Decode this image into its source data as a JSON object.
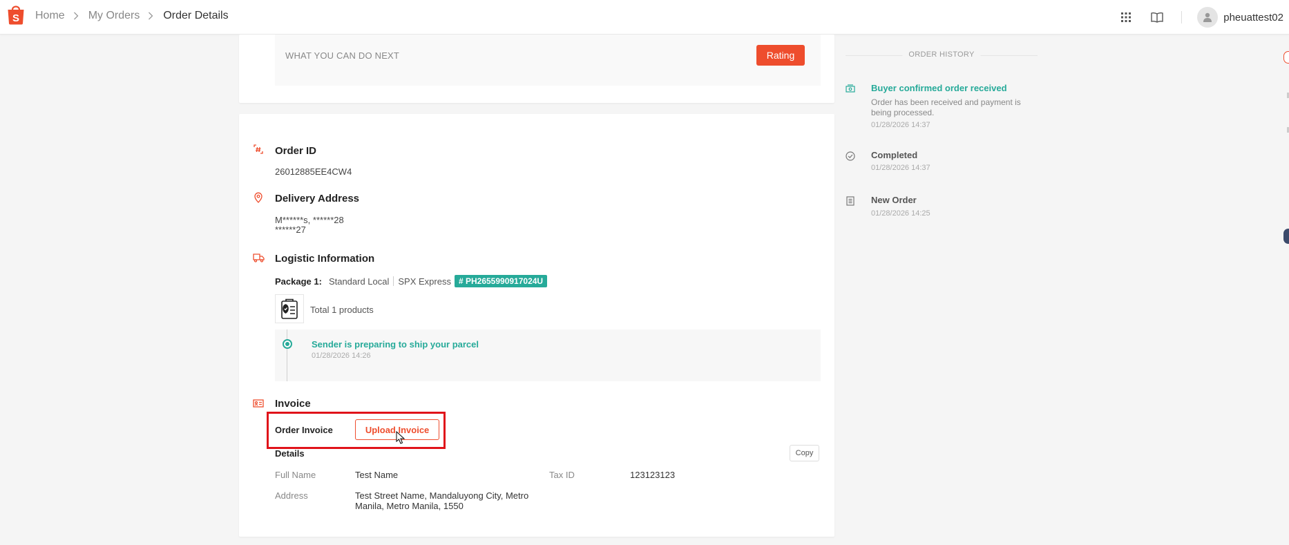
{
  "header": {
    "breadcrumb": [
      "Home",
      "My Orders",
      "Order Details"
    ],
    "username": "pheuattest02"
  },
  "next_actions": {
    "label": "WHAT YOU CAN DO NEXT",
    "rating_button": "Rating"
  },
  "order": {
    "order_id_title": "Order ID",
    "order_id": "26012885EE4CW4",
    "delivery_title": "Delivery Address",
    "address_line1": "M******s, ******28",
    "address_line2": "******27",
    "logistic_title": "Logistic Information",
    "package_label": "Package 1:",
    "shipping_type": "Standard Local",
    "carrier": "SPX Express",
    "tracking_number": "# PH2655990917024U",
    "product_count": "Total 1 products",
    "tracking_event": {
      "title": "Sender is preparing to ship your parcel",
      "time": "01/28/2026 14:26"
    }
  },
  "invoice": {
    "title": "Invoice",
    "order_invoice_label": "Order Invoice",
    "upload_button": "Upload Invoice",
    "details_title": "Details",
    "copy_button": "Copy",
    "full_name_label": "Full Name",
    "full_name": "Test Name",
    "tax_id_label": "Tax ID",
    "tax_id": "123123123",
    "address_label": "Address",
    "address_line1": "Test Street Name, Mandaluyong City, Metro",
    "address_line2": "Manila, Metro Manila, 1550"
  },
  "order_history": {
    "title": "ORDER HISTORY",
    "items": [
      {
        "title": "Buyer confirmed order received",
        "desc": "Order has been received and payment is being processed.",
        "time": "01/28/2026 14:37"
      },
      {
        "title": "Completed",
        "desc": "",
        "time": "01/28/2026 14:37"
      },
      {
        "title": "New Order",
        "desc": "",
        "time": "01/28/2026 14:25"
      }
    ]
  },
  "colors": {
    "brand": "#ee4d2d",
    "teal": "#26aa99",
    "highlight": "#e0131a"
  }
}
